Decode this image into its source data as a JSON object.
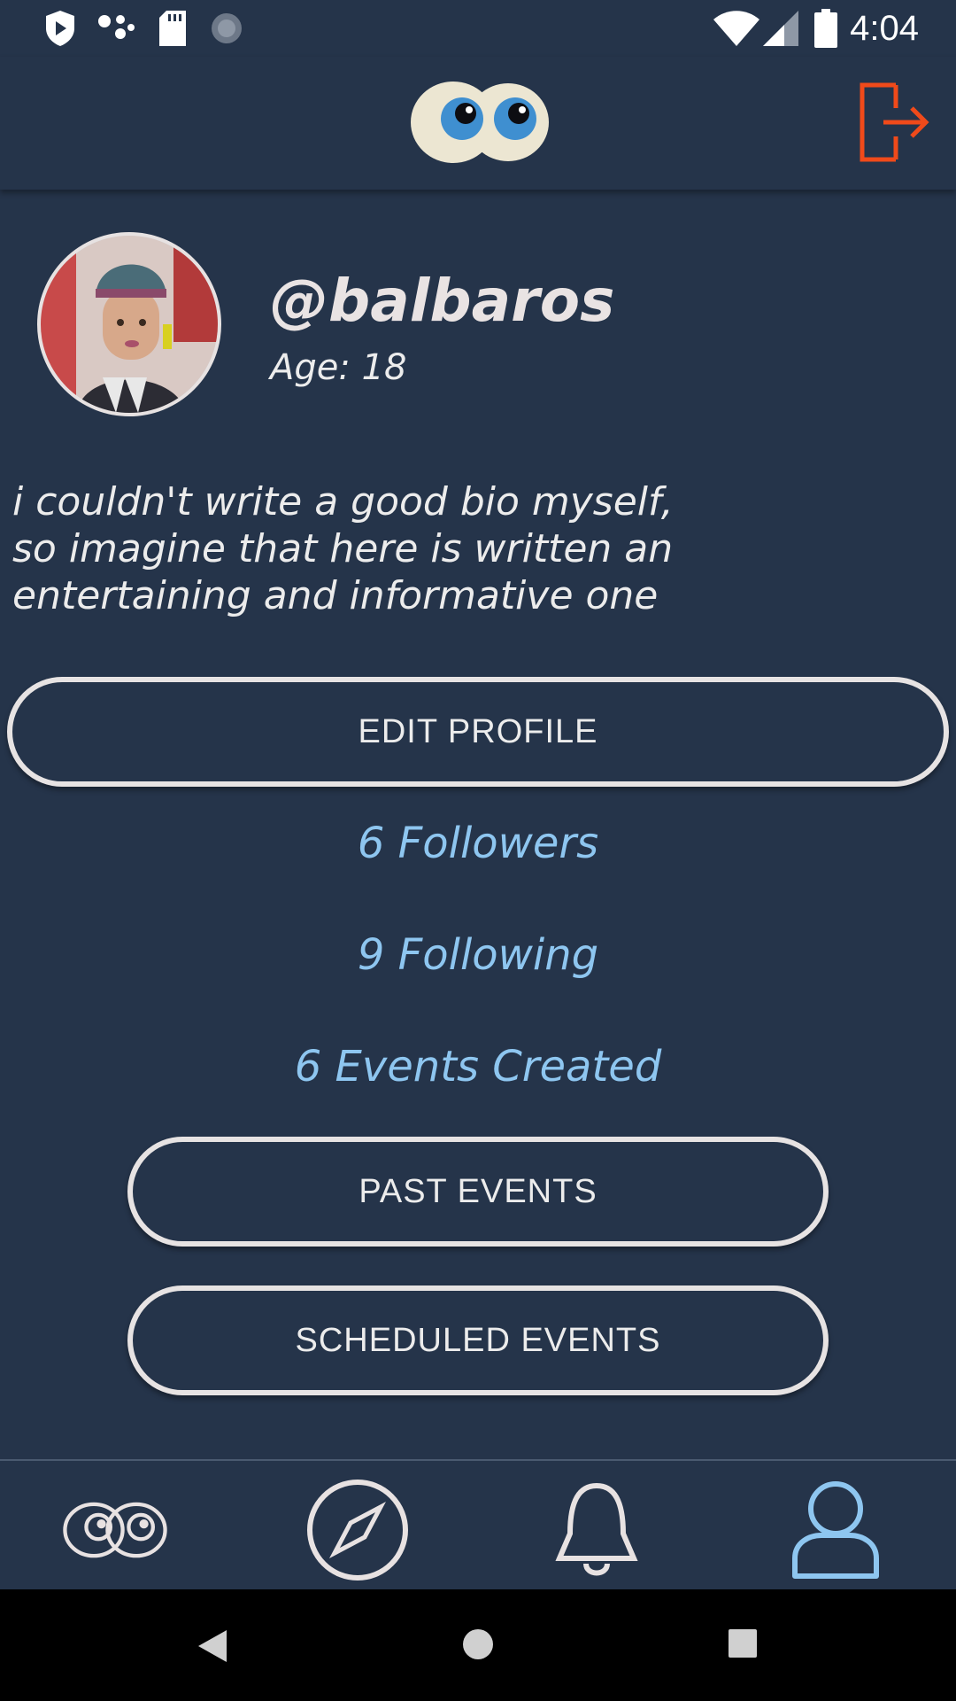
{
  "status_bar": {
    "time": "4:04",
    "icons": [
      "shield-icon",
      "assistant-dots-icon",
      "sd-card-icon",
      "loading-icon",
      "wifi-icon",
      "signal-icon",
      "battery-icon"
    ]
  },
  "header": {
    "logo": "eyes-logo-icon",
    "logout_icon": "logout-icon",
    "accent_color": "#f04a1a"
  },
  "profile": {
    "username": "@balbaros",
    "age": "Age: 18",
    "bio": "i couldn't write a good bio myself,\nso imagine that here is written an\nentertaining and informative one"
  },
  "buttons": {
    "edit_profile": "EDIT PROFILE",
    "past_events": "PAST EVENTS",
    "scheduled_events": "SCHEDULED EVENTS"
  },
  "stats": {
    "followers": "6 Followers",
    "following": "9 Following",
    "events_created": "6 Events Created"
  },
  "bottom_nav": {
    "items": [
      "eyes-home-icon",
      "compass-icon",
      "bell-icon",
      "profile-icon"
    ],
    "active": "profile-icon",
    "active_color": "#8ec6f0"
  },
  "system_nav": [
    "back-icon",
    "home-icon",
    "recents-icon"
  ]
}
